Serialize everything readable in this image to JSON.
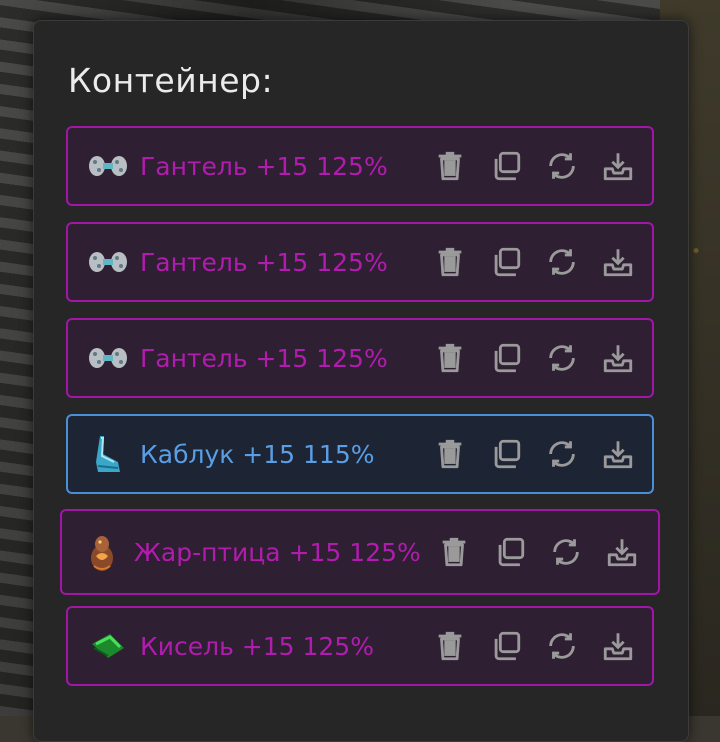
{
  "container": {
    "title": "Контейнер:"
  },
  "items": [
    {
      "label": "Гантель +15 125%",
      "rarity": "purple",
      "icon": "dumbbell-icon"
    },
    {
      "label": "Гантель +15 125%",
      "rarity": "purple",
      "icon": "dumbbell-icon"
    },
    {
      "label": "Гантель +15 125%",
      "rarity": "purple",
      "icon": "dumbbell-icon"
    },
    {
      "label": "Каблук +15 115%",
      "rarity": "blue",
      "icon": "heel-icon"
    },
    {
      "label": "Жар-птица +15 125%",
      "rarity": "purple",
      "icon": "firebird-icon"
    },
    {
      "label": "Кисель +15 125%",
      "rarity": "purple",
      "icon": "jelly-icon"
    }
  ],
  "actions": [
    "trash-icon",
    "copy-icon",
    "refresh-icon",
    "download-icon"
  ],
  "colors": {
    "purple_border": "#a116a7",
    "purple_text": "#b21cae",
    "blue_border": "#4a8ed9",
    "blue_text": "#5a9ee6",
    "icon_gray": "#9a9a9a"
  }
}
